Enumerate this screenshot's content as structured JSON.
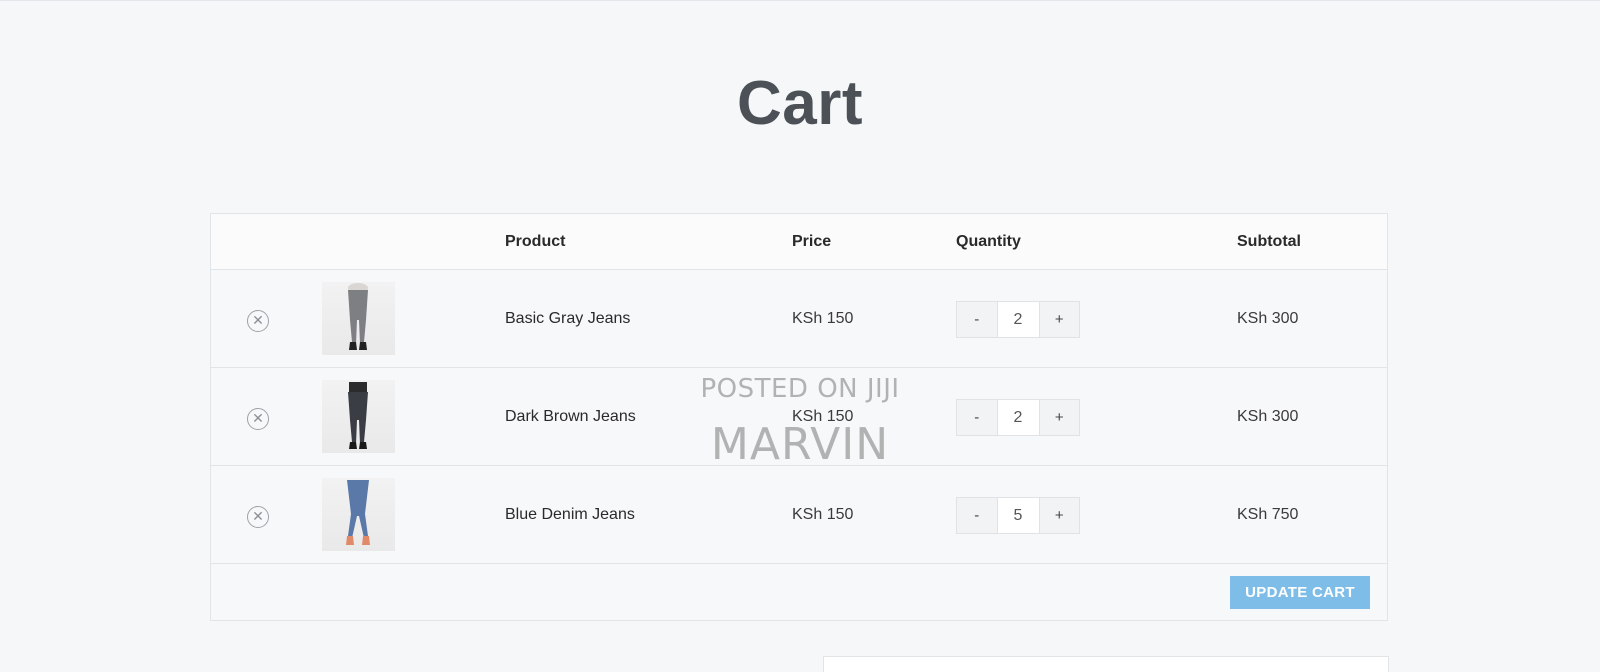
{
  "page": {
    "title": "Cart"
  },
  "table": {
    "headers": {
      "product": "Product",
      "price": "Price",
      "quantity": "Quantity",
      "subtotal": "Subtotal"
    },
    "rows": [
      {
        "name": "Basic Gray Jeans",
        "price": "KSh 150",
        "quantity": "2",
        "subtotal": "KSh 300",
        "jeans_color": "#7d7f82",
        "shoe_color": "#222222"
      },
      {
        "name": "Dark Brown Jeans",
        "price": "KSh 150",
        "quantity": "2",
        "subtotal": "KSh 300",
        "jeans_color": "#3b3d44",
        "shoe_color": "#1a1a1a"
      },
      {
        "name": "Blue Denim Jeans",
        "price": "KSh 150",
        "quantity": "5",
        "subtotal": "KSh 750",
        "jeans_color": "#5a78a8",
        "shoe_color": "#e08a6a"
      }
    ],
    "controls": {
      "minus": "-",
      "plus": "+",
      "remove_glyph": "✕"
    },
    "update_button": "UPDATE CART"
  },
  "watermark": {
    "line1": "POSTED ON JIJI",
    "line2": "MARVIN"
  },
  "colors": {
    "accent": "#7dbde8",
    "title": "#4c5157",
    "background": "#f5f7f9"
  }
}
